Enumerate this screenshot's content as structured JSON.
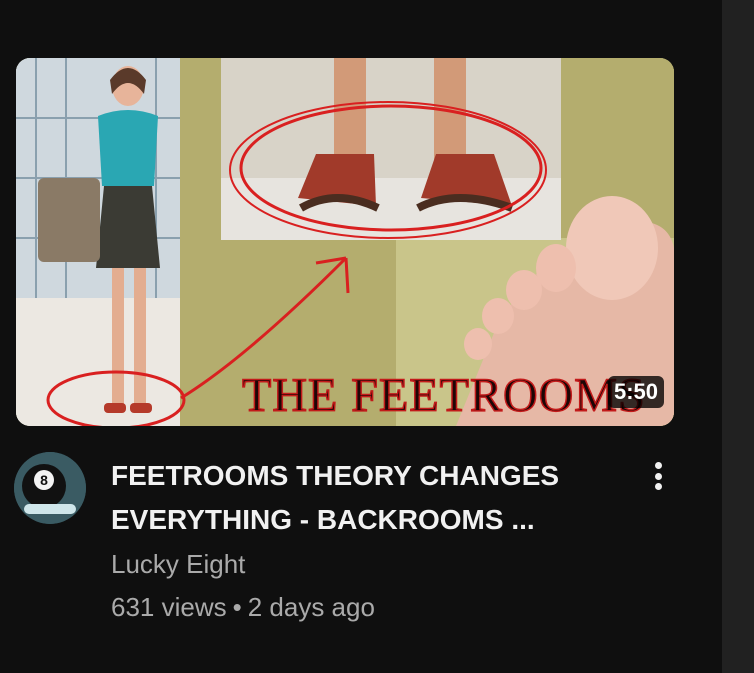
{
  "video": {
    "overlay_text": "THE FEETROOMS",
    "duration": "5:50",
    "title_line1": "FEETROOMS THEORY CHANGES",
    "title_line2": "EVERYTHING - BACKROOMS ...",
    "channel": "Lucky Eight",
    "views": "631 views",
    "separator": "•",
    "age": "2 days ago"
  },
  "icons": {
    "menu": "more-vertical-icon",
    "avatar": "eight-ball-avatar"
  },
  "colors": {
    "background": "#0f0f0f",
    "title": "#f1f1f1",
    "meta": "#aaaaaa",
    "annotation_red": "#d92020"
  }
}
